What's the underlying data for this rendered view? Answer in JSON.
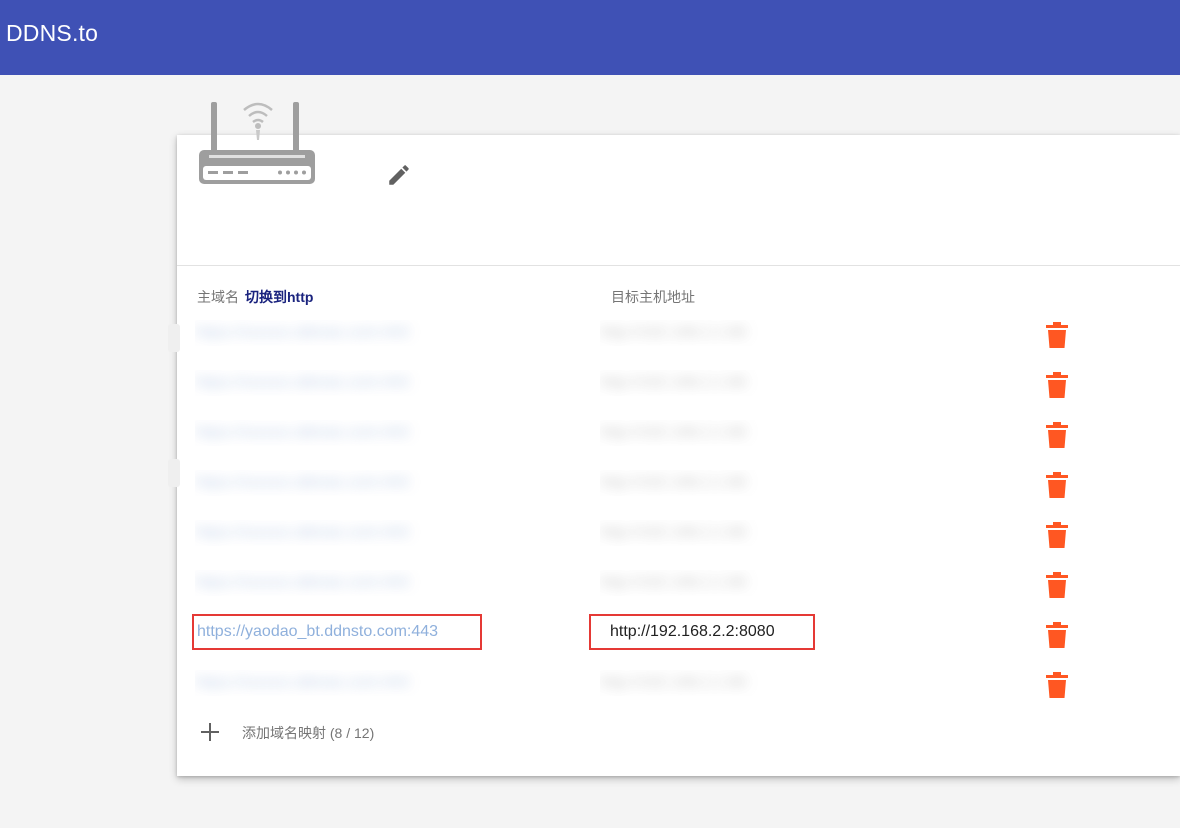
{
  "app": {
    "title": "DDNS.to"
  },
  "table": {
    "host_header": "主域名",
    "switch_link": "切换到http",
    "target_header": "目标主机地址"
  },
  "rows": [
    {
      "host": "https://xxxxxx.ddnsto.com:443",
      "target": "http://192.168.2.1:80",
      "redacted": true
    },
    {
      "host": "https://xxxxxx.ddnsto.com:443",
      "target": "http://192.168.2.1:80",
      "redacted": true
    },
    {
      "host": "https://xxxxxx.ddnsto.com:443",
      "target": "http://192.168.2.1:80",
      "redacted": true
    },
    {
      "host": "https://xxxxxx.ddnsto.com:443",
      "target": "http://192.168.2.1:80",
      "redacted": true
    },
    {
      "host": "https://xxxxxx.ddnsto.com:443",
      "target": "http://192.168.2.1:80",
      "redacted": true
    },
    {
      "host": "https://xxxxxx.ddnsto.com:443",
      "target": "http://192.168.2.1:80",
      "redacted": true
    },
    {
      "host": "https://yaodao_bt.ddnsto.com:443",
      "target": "http://192.168.2.2:8080",
      "redacted": false
    },
    {
      "host": "https://xxxxxx.ddnsto.com:443",
      "target": "http://192.168.2.1:80",
      "redacted": true
    }
  ],
  "add": {
    "label": "添加域名映射 (8 / 12)"
  },
  "colors": {
    "appbar": "#3f51b5",
    "delete": "#ff5722",
    "highlight": "#e53935",
    "link": "#8fb0dc",
    "switch_link": "#1a237e"
  },
  "icons": {
    "device": "router-icon",
    "edit": "pencil-icon",
    "delete": "trash-icon",
    "add": "plus-icon"
  }
}
